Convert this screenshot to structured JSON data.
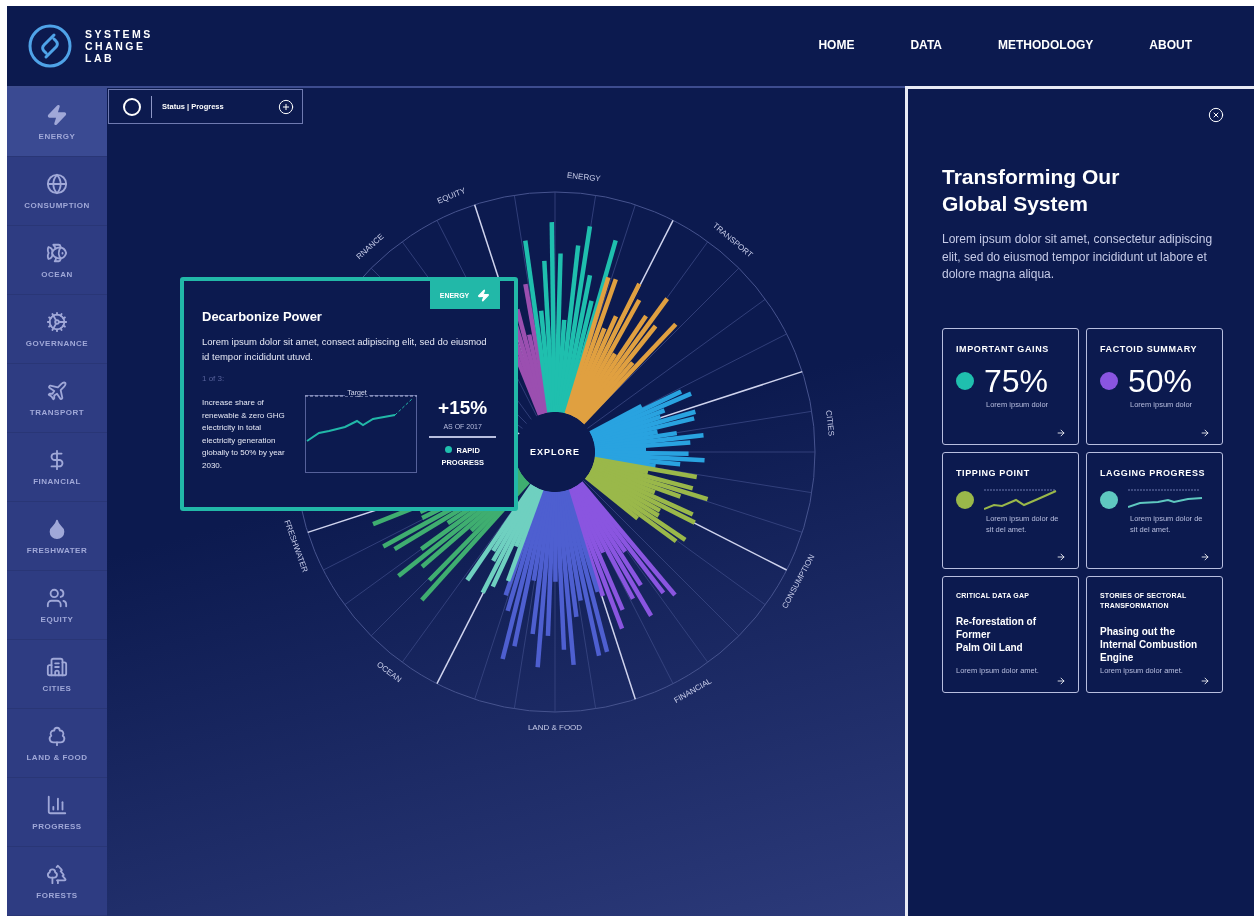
{
  "header": {
    "logo_text": [
      "SYSTEMS",
      "CHANGE",
      "LAB"
    ],
    "nav": [
      {
        "label": "HOME",
        "selected": false
      },
      {
        "label": "DATA",
        "selected": false
      },
      {
        "label": "METHODOLOGY",
        "selected": false
      },
      {
        "label": "ABOUT",
        "selected": false
      }
    ]
  },
  "sidebar": {
    "items": [
      {
        "label": "ENERGY",
        "selected": true
      },
      {
        "label": "CONSUMPTION",
        "selected": false
      },
      {
        "label": "OCEAN",
        "selected": false
      },
      {
        "label": "GOVERNANCE",
        "selected": false
      },
      {
        "label": "TRANSPORT",
        "selected": false
      },
      {
        "label": "FINANCIAL",
        "selected": false
      },
      {
        "label": "FRESHWATER",
        "selected": false
      },
      {
        "label": "EQUITY",
        "selected": false
      },
      {
        "label": "CITIES",
        "selected": false
      },
      {
        "label": "LAND & FOOD",
        "selected": false
      },
      {
        "label": "PROGRESS",
        "selected": false
      },
      {
        "label": "FORESTS",
        "selected": false
      }
    ]
  },
  "status_control": {
    "label": "Status | Progress"
  },
  "radial_chart": {
    "center_label": "EXPLORE",
    "sector_labels": [
      "ENERGY",
      "TRANSPORT",
      "CITIES",
      "CONSUMPTION",
      "FINANCIAL",
      "LAND & FOOD",
      "OCEAN",
      "FRESHWATER",
      "RNANCE",
      "EQUITY"
    ]
  },
  "popup": {
    "tag": "ENERGY",
    "title": "Decarbonize Power",
    "body": "Lorem ipsum dolor sit amet, consect adipiscing elit, sed do eiusmod id tempor incididunt utuvd.",
    "counter": "1 of 3:",
    "description": "Increase share of renewable & zero GHG electricity in total electricity generation globally to 50% by year 2030.",
    "target_label": "Target",
    "change": "+15%",
    "as_of": "AS OF 2017",
    "status": {
      "label": "RAPID PROGRESS",
      "color": "#1fbfae"
    }
  },
  "panel": {
    "title": "Transforming Our Global System",
    "body": "Lorem ipsum dolor sit amet, consectetur adipiscing elit, sed do eiusmod tempor incididunt ut labore et dolore magna aliqua.",
    "cards": [
      {
        "kind": "stat",
        "title": "IMPORTANT GAINS",
        "value": "75%",
        "caption": "Lorem ipsum dolor",
        "color": "#1fbfae"
      },
      {
        "kind": "stat",
        "title": "FACTOID SUMMARY",
        "value": "50%",
        "caption": "Lorem ipsum dolor",
        "color": "#8a55e0"
      },
      {
        "kind": "trend",
        "title": "TIPPING POINT",
        "caption": "Lorem ipsum dolor de sit del amet.",
        "color": "#9ab84a"
      },
      {
        "kind": "trend",
        "title": "LAGGING PROGRESS",
        "caption": "Lorem ipsum dolor de sit del amet.",
        "color": "#5fc8c0"
      },
      {
        "kind": "story",
        "title": "CRITICAL DATA GAP",
        "headline": "Re-forestation of Former\nPalm Oil Land",
        "caption": "Lorem ipsum dolor amet."
      },
      {
        "kind": "story",
        "title": "STORIES OF SECTORAL TRANSFORMATION",
        "headline": "Phasing out the Internal Combustion Engine",
        "caption": "Lorem ipsum dolor amet."
      }
    ]
  }
}
